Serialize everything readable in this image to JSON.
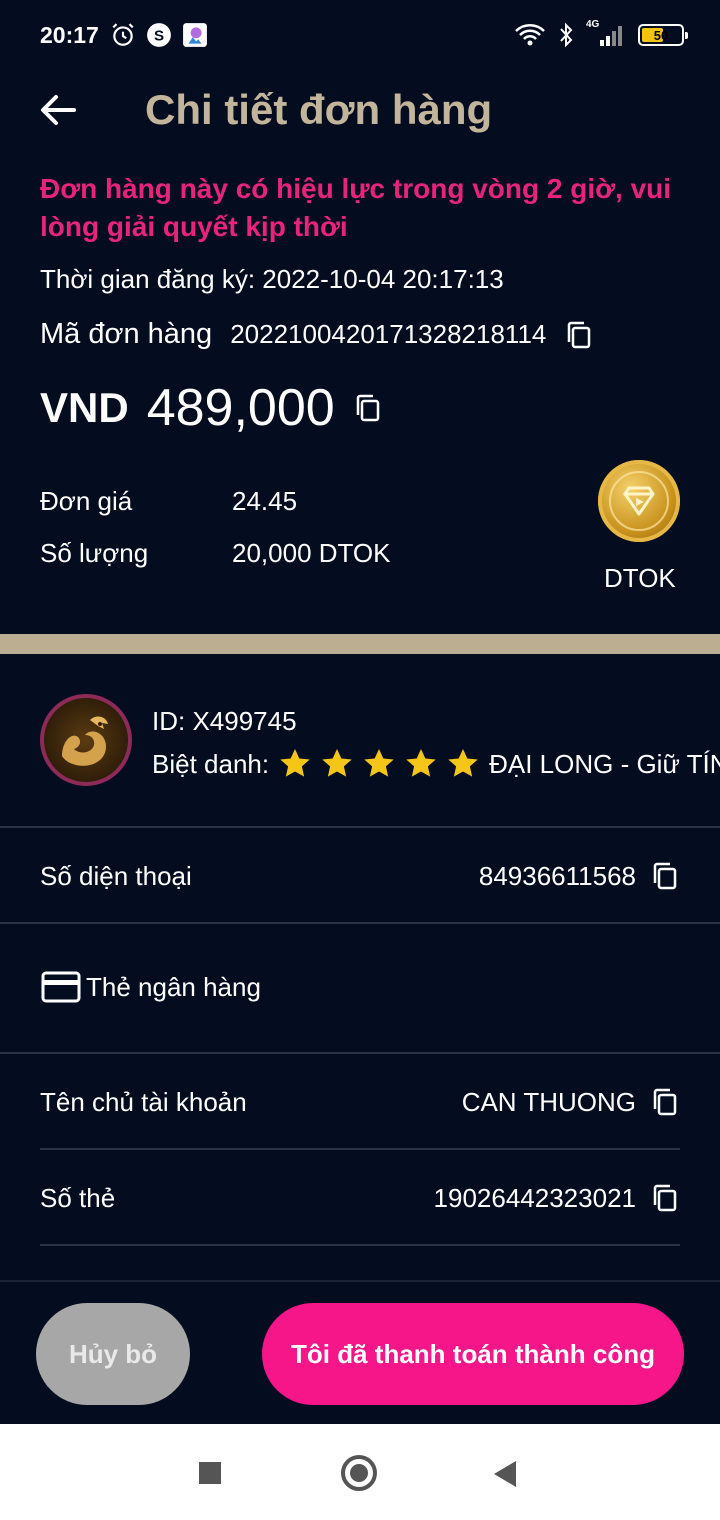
{
  "status_bar": {
    "time": "20:17",
    "network": "4G",
    "battery": "50",
    "icons": [
      "alarm-icon",
      "s-app-icon",
      "app-notification-icon",
      "wifi-icon",
      "bluetooth-icon",
      "signal-icon",
      "battery-icon"
    ]
  },
  "header": {
    "title": "Chi tiết đơn hàng",
    "back_icon": "arrow-left-icon"
  },
  "order": {
    "notice": "Đơn hàng này có hiệu lực trong vòng 2 giờ, vui lòng giải quyết kịp thời",
    "registration_time": "Thời gian đăng ký: 2022-10-04 20:17:13",
    "order_label": "Mã đơn hàng",
    "order_number": "20221004201713282181​14",
    "currency": "VND",
    "amount": "489,000",
    "unit_price_label": "Đơn giá",
    "unit_price": "24.45",
    "quantity_label": "Số lượng",
    "quantity": "20,000 DTOK",
    "token_name": "DTOK"
  },
  "seller": {
    "id": "ID: X499745",
    "nickname_label": "Biệt danh:",
    "star_count": 5,
    "nickname": "ĐẠI LONG - Giữ TÍN"
  },
  "details": {
    "phone_label": "Số diện thoại",
    "phone": "84936611568",
    "bank_card_label": "Thẻ ngân hàng",
    "account_holder_label": "Tên chủ tài khoản",
    "account_holder": "CAN THUONG",
    "card_number_label": "Số thẻ",
    "card_number": "19026442323021"
  },
  "actions": {
    "cancel": "Hủy bỏ",
    "paid": "Tôi đã thanh toán thành công"
  },
  "colors": {
    "background": "#040d20",
    "title": "#c2b59b",
    "notice": "#e8237d",
    "divider": "#bcae90",
    "primary_button": "#f7168a",
    "secondary_button": "#a7a7a7",
    "star": "#f5c518"
  }
}
